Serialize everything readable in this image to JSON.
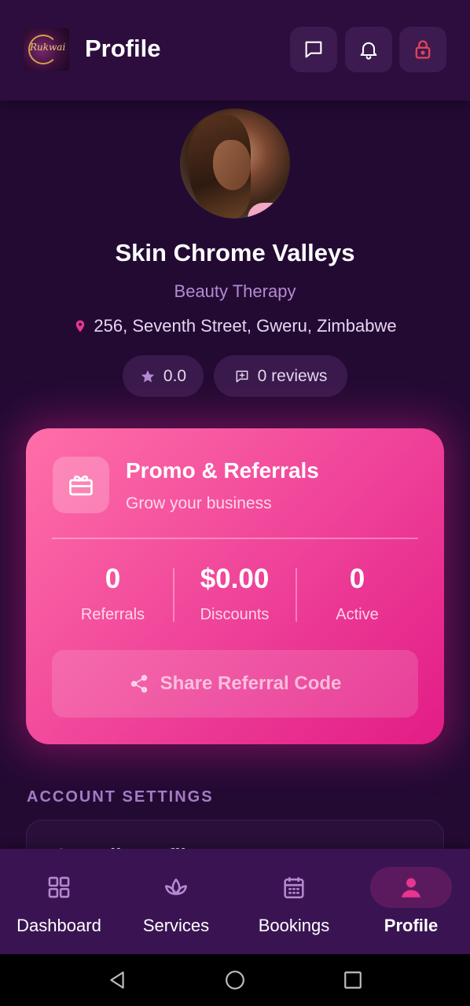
{
  "header": {
    "title": "Profile",
    "logo_text": "Rukwai",
    "actions": [
      "chat-icon",
      "bell-icon",
      "lock-icon"
    ],
    "accent_color": "#e0445a"
  },
  "profile": {
    "name": "Skin Chrome Valleys",
    "category": "Beauty Therapy",
    "address": "256, Seventh Street, Gweru, Zimbabwe",
    "rating": "0.0",
    "reviews": "0 reviews"
  },
  "promo": {
    "title": "Promo & Referrals",
    "subtitle": "Grow your business",
    "stats": [
      {
        "value": "0",
        "label": "Referrals"
      },
      {
        "value": "$0.00",
        "label": "Discounts"
      },
      {
        "value": "0",
        "label": "Active"
      }
    ],
    "share_label": "Share Referral Code",
    "gradient": [
      "#ff6fa8",
      "#e21c86"
    ]
  },
  "settings": {
    "title": "ACCOUNT SETTINGS",
    "first_item": "Edit Profile"
  },
  "nav": {
    "items": [
      {
        "label": "Dashboard",
        "icon": "grid-icon"
      },
      {
        "label": "Services",
        "icon": "lotus-icon"
      },
      {
        "label": "Bookings",
        "icon": "calendar-icon"
      },
      {
        "label": "Profile",
        "icon": "person-icon",
        "active": true
      }
    ],
    "active_color": "#e8358f"
  }
}
